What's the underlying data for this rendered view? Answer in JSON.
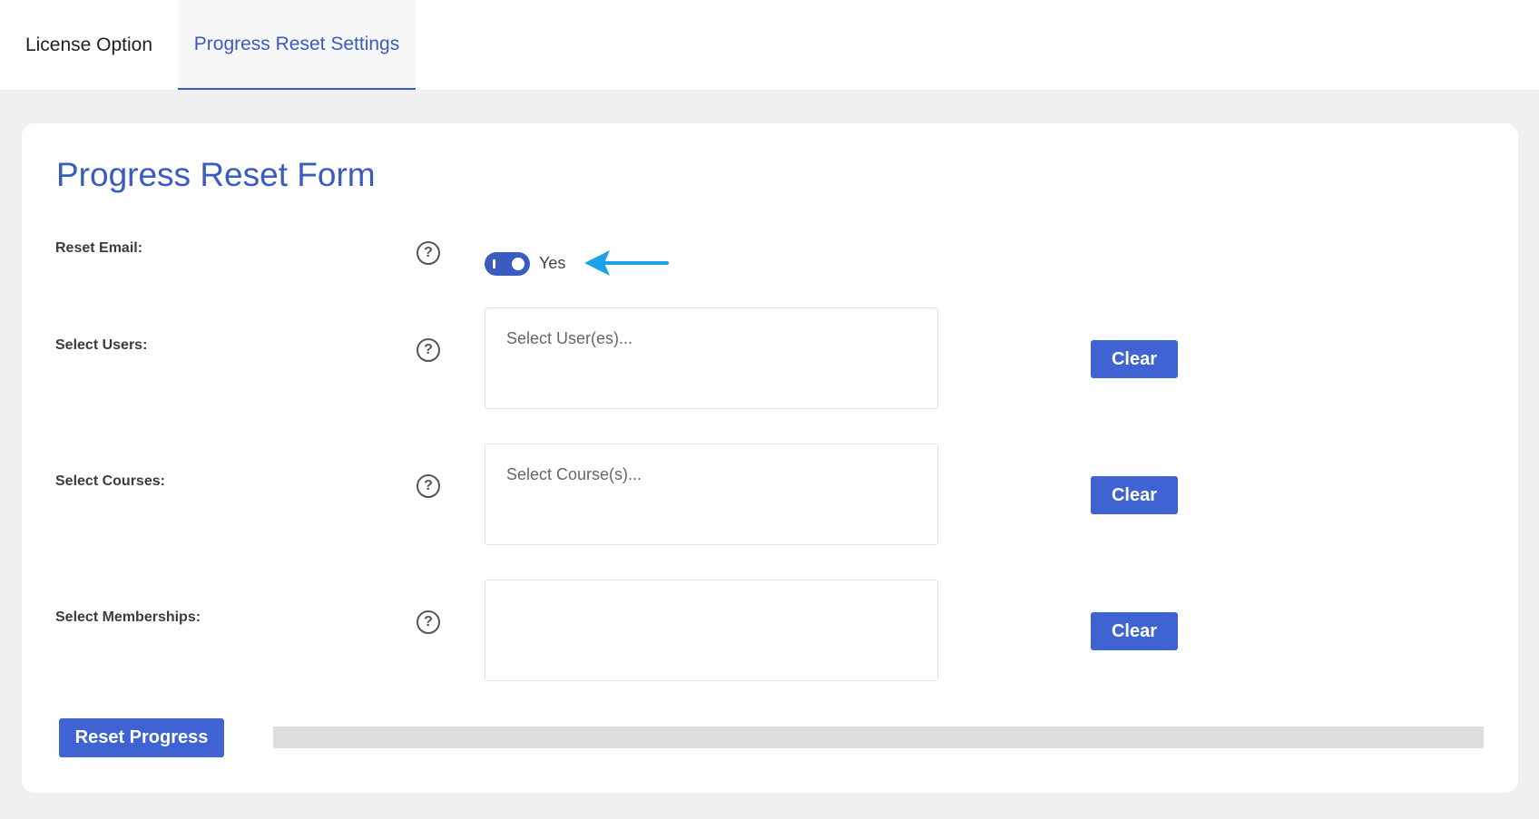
{
  "tabs": [
    {
      "label": "License Option",
      "active": false
    },
    {
      "label": "Progress Reset Settings",
      "active": true
    }
  ],
  "form": {
    "title": "Progress Reset Form",
    "reset_email": {
      "label": "Reset Email:",
      "toggle_on": true,
      "toggle_text": "Yes"
    },
    "select_users": {
      "label": "Select Users:",
      "placeholder": "Select User(es)...",
      "clear_label": "Clear"
    },
    "select_courses": {
      "label": "Select Courses:",
      "placeholder": "Select Course(s)...",
      "clear_label": "Clear"
    },
    "select_memberships": {
      "label": "Select Memberships:",
      "placeholder": "",
      "clear_label": "Clear"
    },
    "help_glyph": "?",
    "reset_button_label": "Reset Progress",
    "progress_percent": 0
  },
  "colors": {
    "accent": "#3f63d3",
    "title": "#3a5bbf",
    "annotation_arrow": "#1aa3e8"
  },
  "icons": {
    "help": "help-circle-icon",
    "annotation": "arrow-left-icon"
  }
}
